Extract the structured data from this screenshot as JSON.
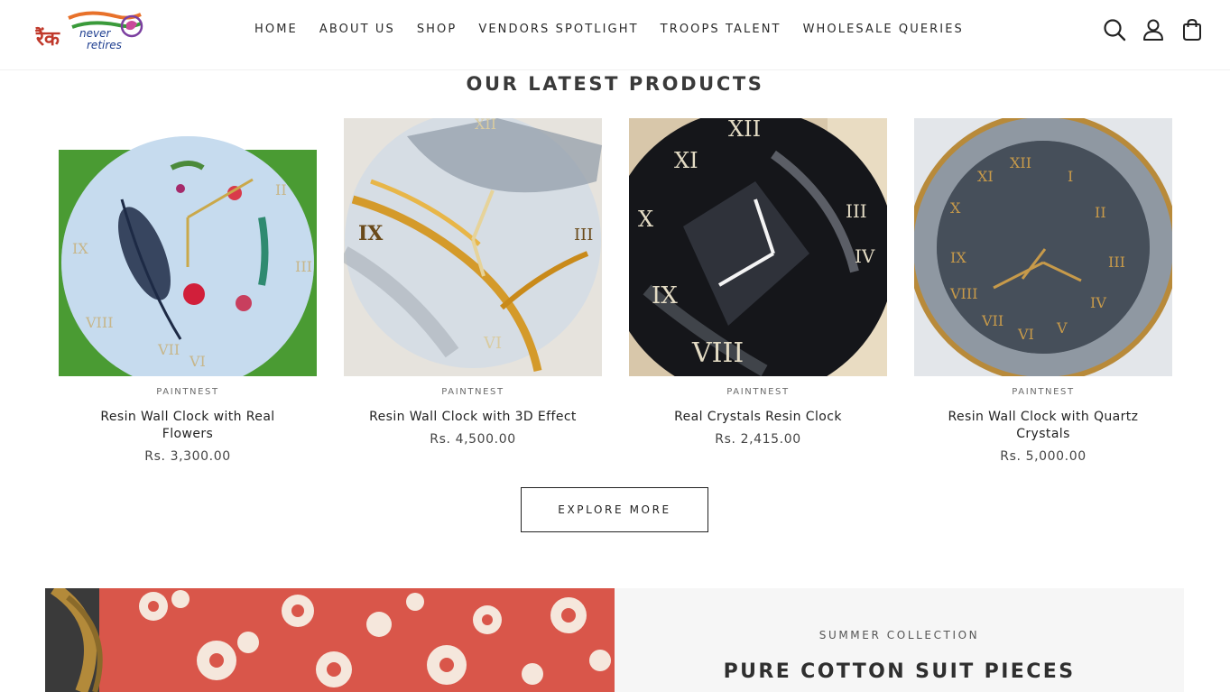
{
  "brand": {
    "logo_text_hindi": "रैंक",
    "logo_text_1": "never",
    "logo_text_2": "retires"
  },
  "nav": {
    "items": [
      "HOME",
      "ABOUT US",
      "SHOP",
      "VENDORS SPOTLIGHT",
      "TROOPS TALENT",
      "WHOLESALE QUERIES"
    ]
  },
  "header_icons": [
    "search-icon",
    "account-icon",
    "cart-icon"
  ],
  "section": {
    "title": "OUR LATEST PRODUCTS"
  },
  "products": [
    {
      "vendor": "PAINTNEST",
      "name": "Resin Wall Clock with Real Flowers",
      "price": "Rs. 3,300.00"
    },
    {
      "vendor": "PAINTNEST",
      "name": "Resin Wall Clock with 3D Effect",
      "price": "Rs. 4,500.00"
    },
    {
      "vendor": "PAINTNEST",
      "name": "Real Crystals Resin Clock",
      "price": "Rs. 2,415.00"
    },
    {
      "vendor": "PAINTNEST",
      "name": "Resin Wall Clock with Quartz Crystals",
      "price": "Rs. 5,000.00"
    }
  ],
  "explore_button": "EXPLORE MORE",
  "banner": {
    "kicker": "SUMMER COLLECTION",
    "title": "PURE COTTON SUIT PIECES"
  },
  "colors": {
    "text_dark": "#2b2b2b",
    "banner_panel": "#f6f6f6",
    "logo_saffron": "#e8712a",
    "logo_green": "#3a9a3a",
    "logo_navy": "#1d3d8f"
  }
}
